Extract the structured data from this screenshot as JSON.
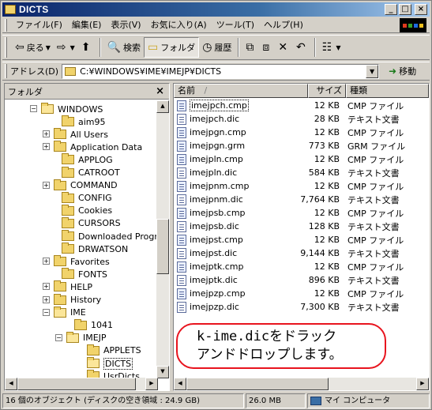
{
  "window": {
    "title": "DICTS"
  },
  "title_buttons": {
    "minimize": "_",
    "maximize": "□",
    "close": "×"
  },
  "menu": [
    "ファイル(F)",
    "編集(E)",
    "表示(V)",
    "お気に入り(A)",
    "ツール(T)",
    "ヘルプ(H)"
  ],
  "toolbar": {
    "back": "戻る",
    "search": "検索",
    "folders": "フォルダ",
    "history": "履歴"
  },
  "address": {
    "label": "アドレス(D)",
    "path": "C:¥WINDOWS¥IME¥IMEJP¥DICTS",
    "go": "移動"
  },
  "folders_pane": {
    "title": "フォルダ",
    "close": "×",
    "items": [
      {
        "label": "WINDOWS",
        "expander": "−"
      },
      {
        "label": "aim95",
        "expander": ""
      },
      {
        "label": "All Users",
        "expander": "+"
      },
      {
        "label": "Application Data",
        "expander": "+"
      },
      {
        "label": "APPLOG",
        "expander": ""
      },
      {
        "label": "CATROOT",
        "expander": ""
      },
      {
        "label": "COMMAND",
        "expander": "+"
      },
      {
        "label": "CONFIG",
        "expander": ""
      },
      {
        "label": "Cookies",
        "expander": ""
      },
      {
        "label": "CURSORS",
        "expander": ""
      },
      {
        "label": "Downloaded Progr",
        "expander": ""
      },
      {
        "label": "DRWATSON",
        "expander": ""
      },
      {
        "label": "Favorites",
        "expander": "+"
      },
      {
        "label": "FONTS",
        "expander": ""
      },
      {
        "label": "HELP",
        "expander": "+"
      },
      {
        "label": "History",
        "expander": "+"
      },
      {
        "label": "IME",
        "expander": "−"
      },
      {
        "label": "1041",
        "expander": ""
      },
      {
        "label": "IMEJP",
        "expander": "−"
      },
      {
        "label": "APPLETS",
        "expander": ""
      },
      {
        "label": "DICTS",
        "expander": ""
      },
      {
        "label": "UsrDicts",
        "expander": ""
      }
    ]
  },
  "file_list": {
    "headers": {
      "name": "名前",
      "size": "サイズ",
      "type": "種類",
      "sort_indicator": "/"
    },
    "rows": [
      {
        "name": "imejpch.cmp",
        "size": "12 KB",
        "type": "CMP ファイル",
        "kind": "cmp"
      },
      {
        "name": "imejpch.dic",
        "size": "28 KB",
        "type": "テキスト文書",
        "kind": "dic"
      },
      {
        "name": "imejpgn.cmp",
        "size": "12 KB",
        "type": "CMP ファイル",
        "kind": "cmp"
      },
      {
        "name": "imejpgn.grm",
        "size": "773 KB",
        "type": "GRM ファイル",
        "kind": "cmp"
      },
      {
        "name": "imejpln.cmp",
        "size": "12 KB",
        "type": "CMP ファイル",
        "kind": "cmp"
      },
      {
        "name": "imejpln.dic",
        "size": "584 KB",
        "type": "テキスト文書",
        "kind": "dic"
      },
      {
        "name": "imejpnm.cmp",
        "size": "12 KB",
        "type": "CMP ファイル",
        "kind": "cmp"
      },
      {
        "name": "imejpnm.dic",
        "size": "7,764 KB",
        "type": "テキスト文書",
        "kind": "dic"
      },
      {
        "name": "imejpsb.cmp",
        "size": "12 KB",
        "type": "CMP ファイル",
        "kind": "cmp"
      },
      {
        "name": "imejpsb.dic",
        "size": "128 KB",
        "type": "テキスト文書",
        "kind": "dic"
      },
      {
        "name": "imejpst.cmp",
        "size": "12 KB",
        "type": "CMP ファイル",
        "kind": "cmp"
      },
      {
        "name": "imejpst.dic",
        "size": "9,144 KB",
        "type": "テキスト文書",
        "kind": "dic"
      },
      {
        "name": "imejptk.cmp",
        "size": "12 KB",
        "type": "CMP ファイル",
        "kind": "cmp"
      },
      {
        "name": "imejptk.dic",
        "size": "896 KB",
        "type": "テキスト文書",
        "kind": "dic"
      },
      {
        "name": "imejpzp.cmp",
        "size": "12 KB",
        "type": "CMP ファイル",
        "kind": "cmp"
      },
      {
        "name": "imejpzp.dic",
        "size": "7,300 KB",
        "type": "テキスト文書",
        "kind": "dic"
      }
    ]
  },
  "callout": {
    "line1": "k-ime.dicをドラック",
    "line2": "アンドドロップします。"
  },
  "status": {
    "objects": "16 個のオブジェクト (ディスクの空き領域 : 24.9 GB)",
    "size": "26.0 MB",
    "location": "マイ コンピュータ"
  },
  "colors": {
    "titlebar_start": "#0a246a",
    "titlebar_end": "#a6caf0",
    "callout_border": "#e8141e",
    "chrome": "#d4d0c8"
  }
}
